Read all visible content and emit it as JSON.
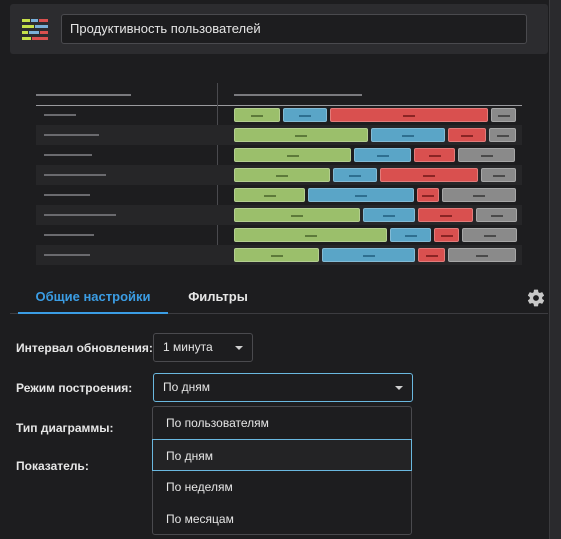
{
  "header": {
    "title": "Продуктивность пользователей",
    "icon": "chart-list-icon"
  },
  "tabs": [
    {
      "label": "Общие настройки",
      "active": true
    },
    {
      "label": "Фильтры",
      "active": false
    }
  ],
  "settings_icon": "gear-icon",
  "form": {
    "refresh_interval": {
      "label": "Интервал обновления:",
      "value": "1 минута"
    },
    "build_mode": {
      "label": "Режим построения:",
      "value": "По дням"
    },
    "chart_type": {
      "label": "Тип диаграммы:"
    },
    "metric": {
      "label": "Показатель:"
    }
  },
  "dropdown": {
    "options": [
      "По пользователям",
      "По дням",
      "По неделям",
      "По месяцам"
    ],
    "selected": "По дням"
  },
  "colors": {
    "accent": "#3b9de4",
    "green": "#9bbf6b",
    "blue": "#5aa5c7",
    "red": "#d9504f",
    "gray": "#8a8a8a"
  },
  "preview_chart": {
    "rows": [
      [
        [
          "green",
          0.17
        ],
        [
          "blue",
          0.16
        ],
        [
          "red",
          0.58
        ],
        [
          "gray",
          0.09
        ]
      ],
      [
        [
          "green",
          0.49
        ],
        [
          "blue",
          0.27
        ],
        [
          "red",
          0.14
        ],
        [
          "gray",
          0.1
        ]
      ],
      [
        [
          "green",
          0.43
        ],
        [
          "blue",
          0.21
        ],
        [
          "red",
          0.15
        ],
        [
          "gray",
          0.21
        ]
      ],
      [
        [
          "green",
          0.35
        ],
        [
          "blue",
          0.16
        ],
        [
          "red",
          0.36
        ],
        [
          "gray",
          0.13
        ]
      ],
      [
        [
          "green",
          0.26
        ],
        [
          "blue",
          0.39
        ],
        [
          "red",
          0.08
        ],
        [
          "gray",
          0.27
        ]
      ],
      [
        [
          "green",
          0.46
        ],
        [
          "blue",
          0.19
        ],
        [
          "red",
          0.2
        ],
        [
          "gray",
          0.15
        ]
      ],
      [
        [
          "green",
          0.56
        ],
        [
          "blue",
          0.15
        ],
        [
          "red",
          0.09
        ],
        [
          "gray",
          0.2
        ]
      ],
      [
        [
          "green",
          0.31
        ],
        [
          "blue",
          0.34
        ],
        [
          "red",
          0.1
        ],
        [
          "gray",
          0.25
        ]
      ]
    ]
  }
}
